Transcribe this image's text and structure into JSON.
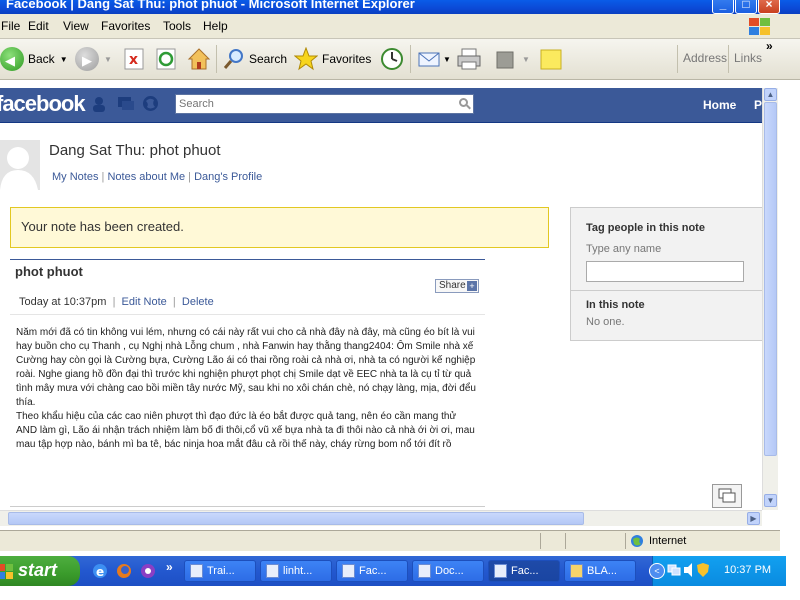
{
  "window": {
    "title": "Facebook | Dang Sat Thu: phot phuot - Microsoft Internet Explorer"
  },
  "menu": [
    "File",
    "Edit",
    "View",
    "Favorites",
    "Tools",
    "Help"
  ],
  "toolbar": {
    "back": "Back",
    "search": "Search",
    "favorites": "Favorites",
    "address": "Address",
    "links": "Links"
  },
  "fb": {
    "logo": "facebook",
    "search_placeholder": "Search",
    "home": "Home"
  },
  "page": {
    "title": "Dang Sat Thu: phot phuot",
    "links": [
      "My Notes",
      "Notes about Me",
      "Dang's Profile"
    ],
    "notice": "Your note has been created.",
    "note_title": "phot phuot",
    "share": "Share",
    "time": "Today at 10:37pm",
    "edit": "Edit Note",
    "delete": "Delete",
    "body_p1": "Năm mới đã có tin không vui lém, nhưng có cái này rất vui cho cả nhà đây nà đây, mà cũng éo bít là vui hay buồn cho cụ Thanh , cụ Nghị nhà Lỗng chum , nhà Fanwin hay thằng thang2404: Ôm Smile nhà xế Cường hay còn gọi là Cường bựa, Cường Lão ái có thai rồng roài cả nhà ơi, nhà ta có người kế nghiệp roài. Nghe giang hồ đồn đại thì trước khi nghiện phượt phọt chị Smile dạt về EEC nhà ta là cụ tỉ từ quả tình mây mưa với chàng cao bồi miền tây nước Mỹ, sau khi no xôi chán chè, nó chạy làng, mịa, đời đểu thía.",
    "body_p2": "Theo khẩu hiệu của các cao niên phượt thì đạo đức là éo bắt được quả tang, nên éo cần mang thử AND làm gì, Lão ái nhận trách nhiệm làm bố đi thôi,cổ vũ xế bựa nhà ta đi thôi nào cả nhà ới ời ơi, mau mau tập hợp nào, bánh mì ba tê, bác ninja hoa mắt đâu cả rồi thế này, cháy rừng bom nổ tới đít rồ"
  },
  "sidebar": {
    "tag_heading": "Tag people in this note",
    "tag_hint": "Type any name",
    "in_note_heading": "In this note",
    "in_note_value": "No one."
  },
  "status": {
    "zone": "Internet"
  },
  "taskbar": {
    "start": "start",
    "tasks": [
      {
        "label": "Trai...",
        "active": false
      },
      {
        "label": "linht...",
        "active": false
      },
      {
        "label": "Fac...",
        "active": false
      },
      {
        "label": "Doc...",
        "active": false
      },
      {
        "label": "Fac...",
        "active": true
      },
      {
        "label": "BLA...",
        "active": false
      }
    ],
    "clock": "10:37 PM"
  },
  "colors": {
    "fb_blue": "#3b5998",
    "notice_bg": "#fff9d7",
    "notice_border": "#e2c822",
    "taskbar": "#2358cf",
    "start_green": "#3a9b2b"
  }
}
